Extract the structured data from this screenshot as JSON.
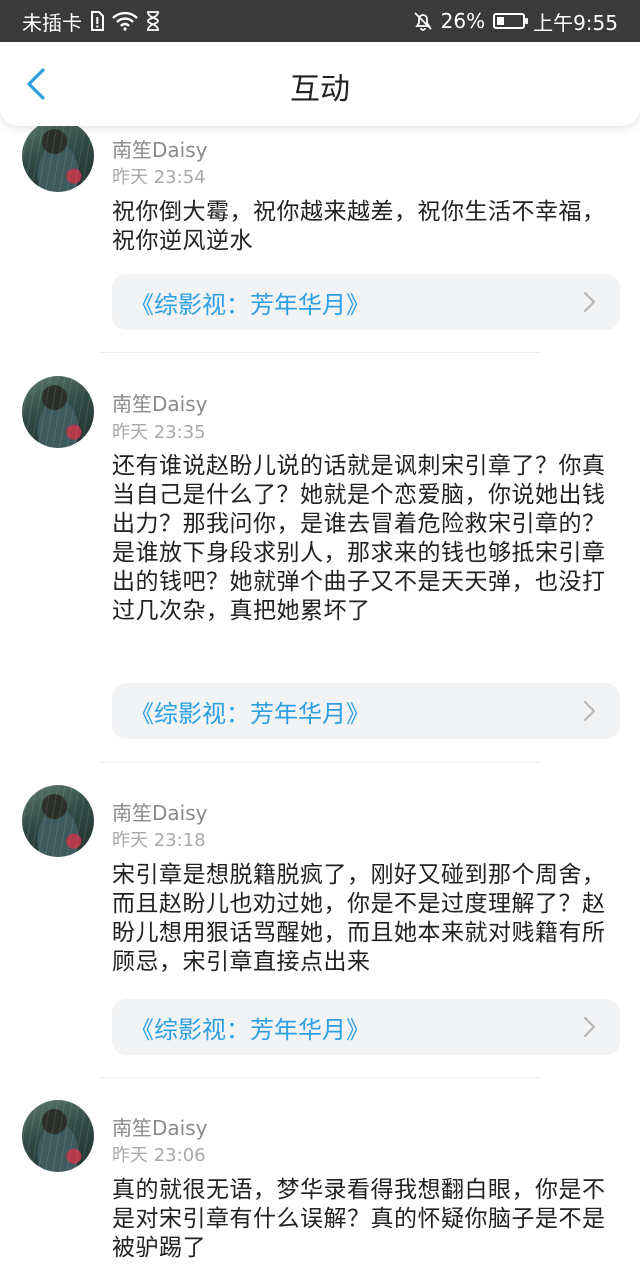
{
  "statusbar": {
    "carrier": "未插卡",
    "battery_percent": "26%",
    "time": "上午9:55"
  },
  "header": {
    "title": "互动"
  },
  "icons": {
    "back": "chevron-left-icon",
    "chevron": "chevron-right-icon",
    "wifi": "wifi-icon",
    "sim": "sim-alert-icon",
    "hourglass": "hourglass-icon",
    "mute": "bell-off-icon",
    "battery": "battery-icon"
  },
  "colors": {
    "accent": "#2f9fe4",
    "statusbar_bg": "#3a3a3a",
    "link_bg": "#f2f3f5"
  },
  "comments": [
    {
      "user": "南笙Daisy",
      "time": "昨天 23:54",
      "text": "祝你倒大霉，祝你越来越差，祝你生活不幸福，祝你逆风逆水",
      "work": "《综影视：芳年华月》"
    },
    {
      "user": "南笙Daisy",
      "time": "昨天 23:35",
      "text": "还有谁说赵盼儿说的话就是讽刺宋引章了？你真当自己是什么了？她就是个恋爱脑，你说她出钱出力？那我问你，是谁去冒着危险救宋引章的？是谁放下身段求别人，那求来的钱也够抵宋引章出的钱吧？她就弹个曲子又不是天天弹，也没打过几次杂，真把她累坏了",
      "work": "《综影视：芳年华月》"
    },
    {
      "user": "南笙Daisy",
      "time": "昨天 23:18",
      "text": "宋引章是想脱籍脱疯了，刚好又碰到那个周舍，而且赵盼儿也劝过她，你是不是过度理解了？赵盼儿想用狠话骂醒她，而且她本来就对贱籍有所顾忌，宋引章直接点出来",
      "work": "《综影视：芳年华月》"
    },
    {
      "user": "南笙Daisy",
      "time": "昨天 23:06",
      "text": "真的就很无语，梦华录看得我想翻白眼，你是不是对宋引章有什么误解？真的怀疑你脑子是不是被驴踢了"
    }
  ]
}
